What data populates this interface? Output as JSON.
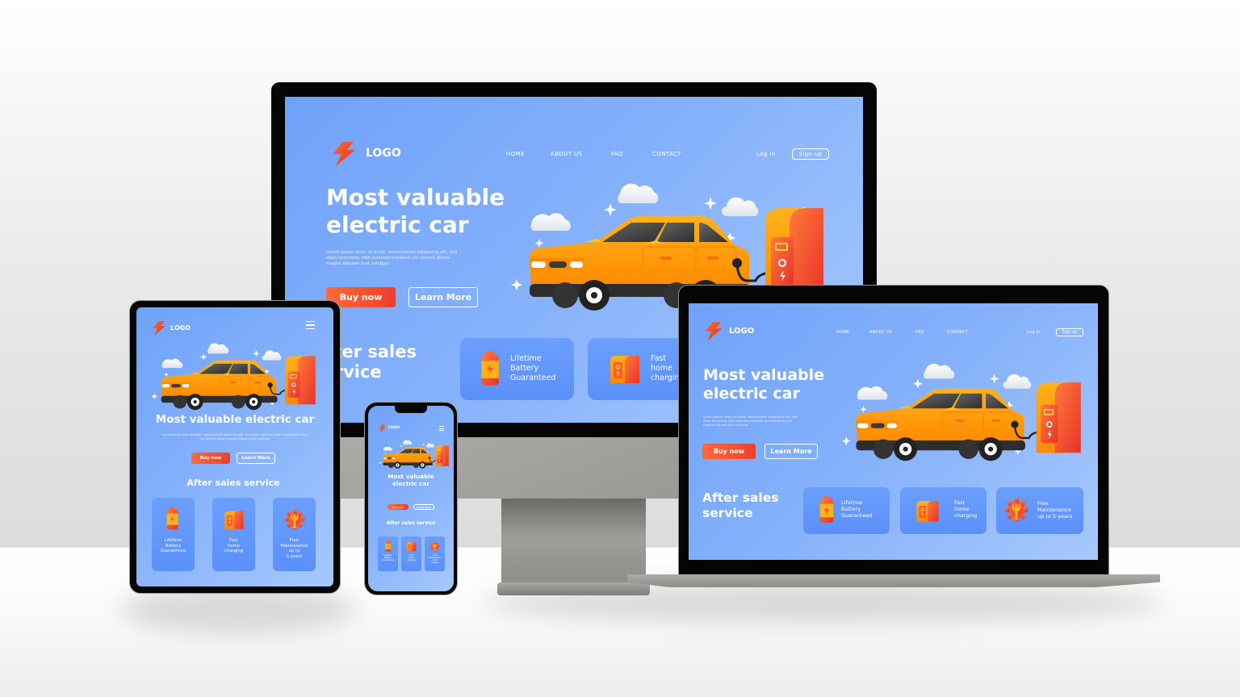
{
  "site": {
    "logo_text": "LOGO",
    "nav": [
      "HOME",
      "ABOUT US",
      "FAQ",
      "CONTACT"
    ],
    "login": "Log in",
    "signup": "Sign up",
    "hero_title_line1": "Most valuable",
    "hero_title_line2": "electric car",
    "hero_title_single": "Most valuable electric car",
    "hero_lorem_1": "Lorem ipsum dolor sit amet, consectetuer adipiscing elit, sed",
    "hero_lorem_2": "diam nonummy nibh euismod tincidunt ute laoreet dolore",
    "hero_lorem_3": "magna aliquam erat volutpat.",
    "buy_now": "Buy now",
    "learn_more": "Learn More",
    "section_title_line1": "After sales",
    "section_title_line2": "service",
    "section_title_single": "After sales service",
    "features": [
      {
        "icon": "battery-icon",
        "line1": "Lifetime",
        "line2": "Battery",
        "line3": "Guaranteed",
        "line4": ""
      },
      {
        "icon": "charger-icon",
        "line1": "Fast",
        "line2": "home",
        "line3": "charging",
        "line4": ""
      },
      {
        "icon": "gear-wrench-icon",
        "line1": "Free",
        "line2": "Maintenance",
        "line3": "up to 5 years",
        "line3_short": "up to",
        "line4": "5 years"
      }
    ],
    "menu_icon": "hamburger-menu-icon"
  },
  "colors": {
    "accent": "#ff5a36",
    "screen_blue": "#7aa9fb",
    "card_blue": "#5f93fb",
    "car_orange": "#ffa10a",
    "device_black": "#0b0b0b",
    "stand_gray": "#a3a29e"
  },
  "devices": [
    "desktop-monitor",
    "tablet",
    "smartphone",
    "laptop"
  ]
}
